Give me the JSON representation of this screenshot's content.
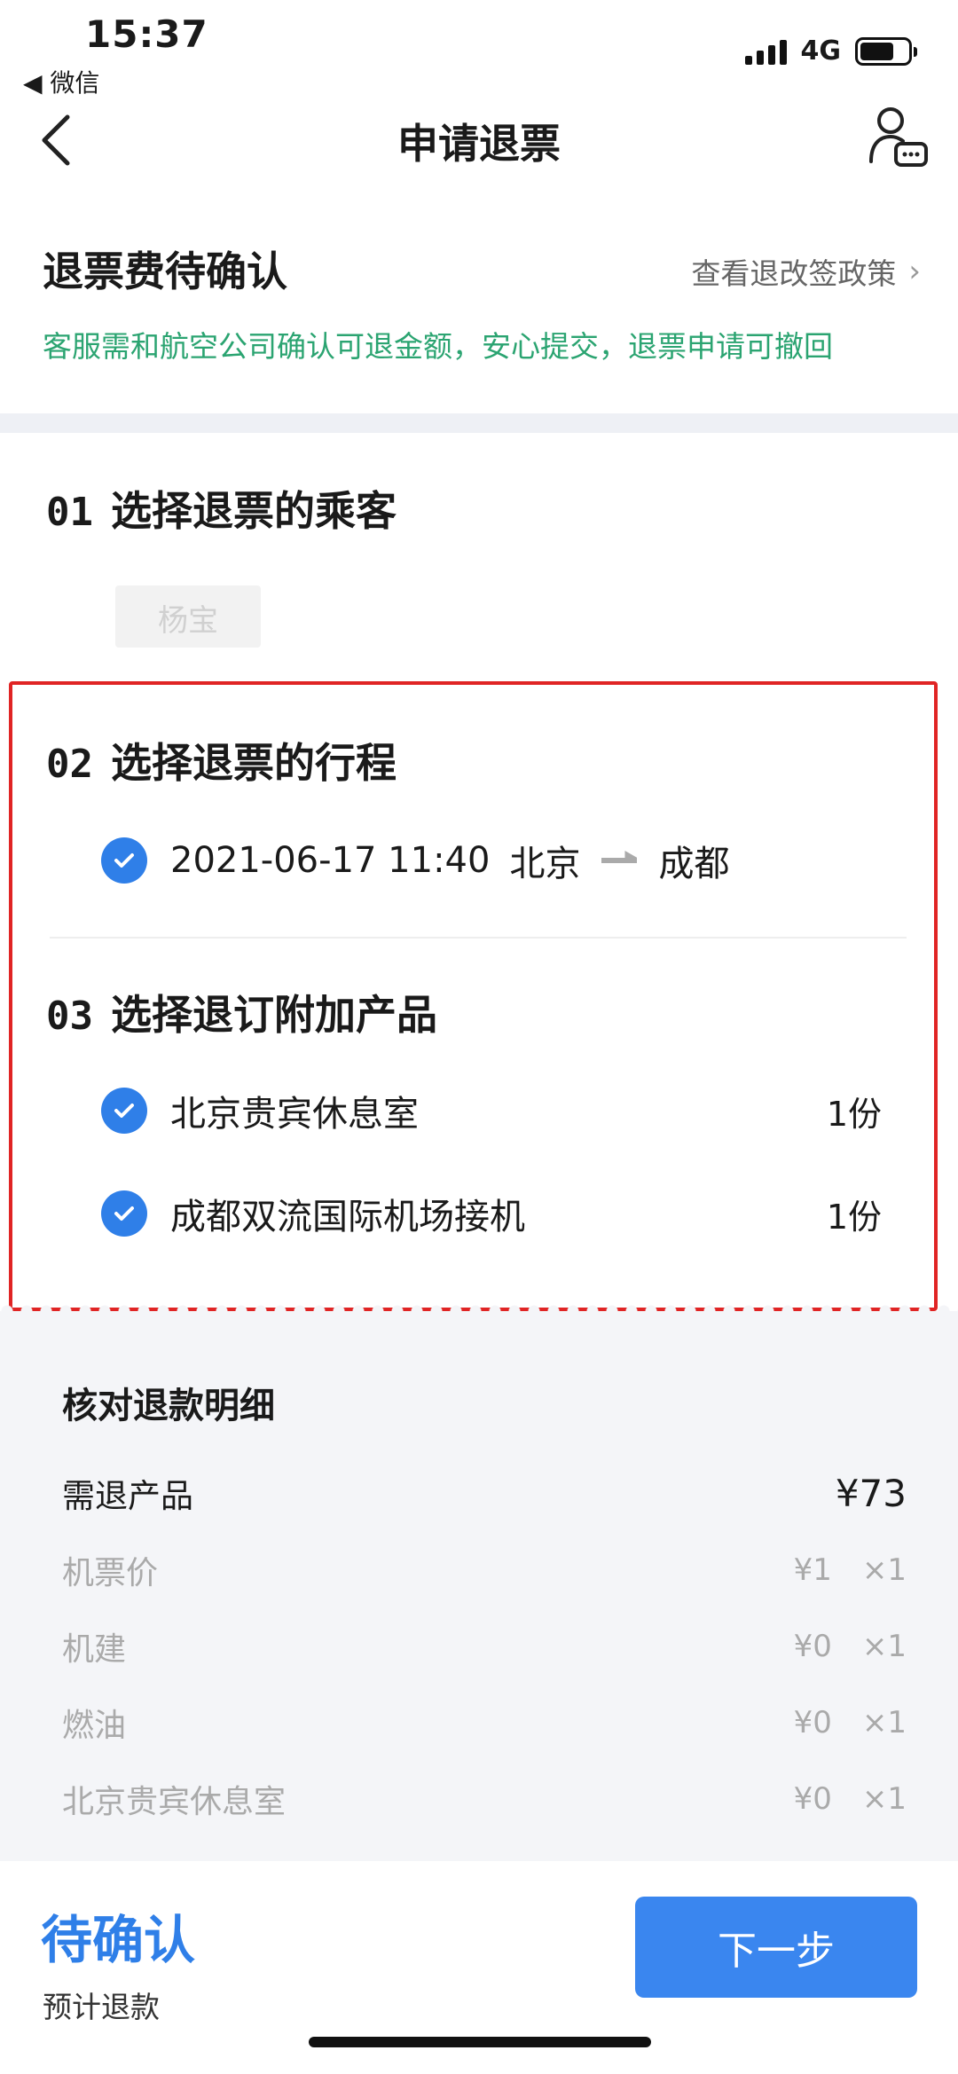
{
  "status_bar": {
    "time": "15:37",
    "back_app": "◀ 微信",
    "network": "4G"
  },
  "nav": {
    "title": "申请退票"
  },
  "header": {
    "title": "退票费待确认",
    "policy_link": "查看退改签政策",
    "notice": "客服需和航空公司确认可退金额，安心提交，退票申请可撤回"
  },
  "sections": [
    {
      "num": "01",
      "title": "选择退票的乘客"
    },
    {
      "num": "02",
      "title": "选择退票的行程"
    },
    {
      "num": "03",
      "title": "选择退订附加产品"
    }
  ],
  "passenger": {
    "name": "杨宝"
  },
  "trip": {
    "datetime": "2021-06-17 11:40",
    "from": "北京",
    "to": "成都"
  },
  "addons": [
    {
      "name": "北京贵宾休息室",
      "qty": "1份"
    },
    {
      "name": "成都双流国际机场接机",
      "qty": "1份"
    }
  ],
  "refund_detail": {
    "title": "核对退款明细",
    "main": {
      "label": "需退产品",
      "amount": "¥73"
    },
    "rows": [
      {
        "label": "机票价",
        "amount": "¥1",
        "qty": "×1"
      },
      {
        "label": "机建",
        "amount": "¥0",
        "qty": "×1"
      },
      {
        "label": "燃油",
        "amount": "¥0",
        "qty": "×1"
      },
      {
        "label": "北京贵宾休息室",
        "amount": "¥0",
        "qty": "×1"
      }
    ]
  },
  "bottom": {
    "status": "待确认",
    "estimated_label": "预计退款",
    "next_button": "下一步"
  },
  "colors": {
    "accent": "#2f7fe8",
    "notice_green": "#2ba471",
    "highlight_red": "#e02424"
  }
}
